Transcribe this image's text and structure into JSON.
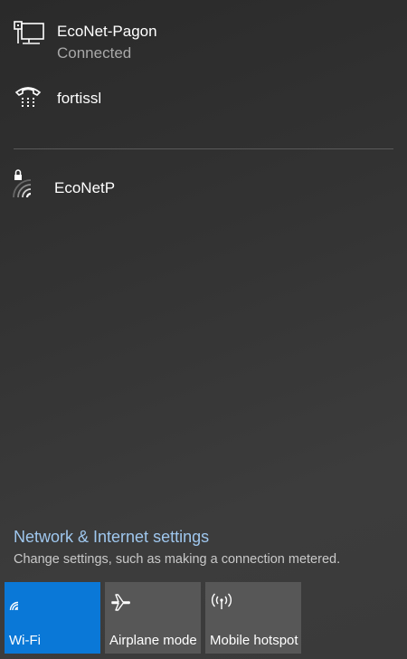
{
  "networks": {
    "connected": {
      "name": "EcoNet-Pagon",
      "status": "Connected",
      "icon": "ethernet-icon"
    },
    "dialup": {
      "name": "fortissl",
      "icon": "dialup-phone-icon"
    },
    "wifi": [
      {
        "name": "EcoNetP",
        "icon": "wifi-secured-icon"
      }
    ]
  },
  "settings": {
    "link_text": "Network & Internet settings",
    "description": "Change settings, such as making a connection metered."
  },
  "quick_actions": [
    {
      "label": "Wi-Fi",
      "icon": "wifi-icon",
      "active": true,
      "color": "#0a78d7"
    },
    {
      "label": "Airplane mode",
      "icon": "airplane-icon",
      "active": false,
      "color": "#575757"
    },
    {
      "label": "Mobile hotspot",
      "icon": "hotspot-icon",
      "active": false,
      "color": "#575757"
    }
  ],
  "colors": {
    "accent": "#0a78d7",
    "link": "#9fc7ee",
    "secondary_text": "#a8a8a8"
  }
}
